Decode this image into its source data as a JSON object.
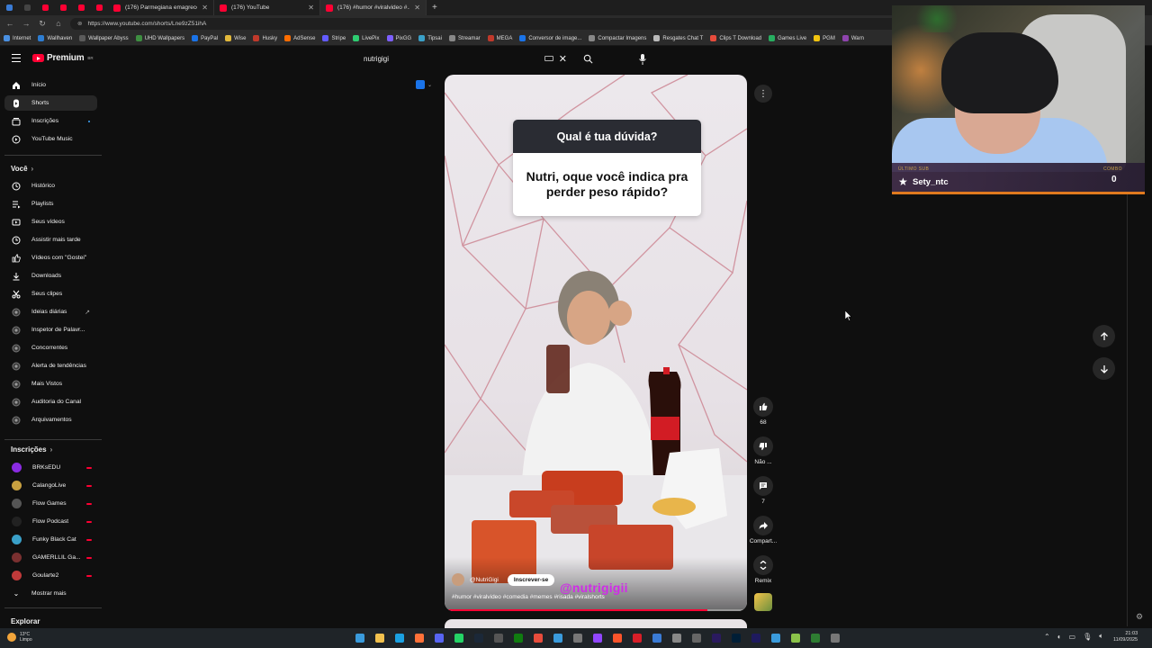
{
  "browser": {
    "tabs": [
      {
        "title": "(176) Parmegiana emagrece #...",
        "active": false
      },
      {
        "title": "(176) YouTube",
        "active": false
      },
      {
        "title": "(176) #humor #viralvideo #...",
        "active": true
      }
    ],
    "url": "https://www.youtube.com/shorts/Lne9zZ51ihA",
    "bookmarks": [
      "Internet",
      "Wallhaven",
      "Wallpaper Abyss",
      "UHD Wallpapers",
      "PayPal",
      "Wise",
      "Husky",
      "AdSense",
      "Stripe",
      "LivePix",
      "PixGG",
      "Tipsai",
      "Streamar",
      "MEGA",
      "Conversor de image...",
      "Compactar Imagens",
      "Resgates Chat T",
      "Clips T Download",
      "Games Live",
      "PGM",
      "Warn"
    ]
  },
  "header": {
    "logo_text": "Premium",
    "logo_sup": "BR",
    "search_value": "nutrigigi"
  },
  "sidebar": {
    "main": [
      {
        "label": "Início",
        "icon": "home-icon"
      },
      {
        "label": "Shorts",
        "icon": "shorts-icon",
        "active": true
      },
      {
        "label": "Inscrições",
        "icon": "subscriptions-icon"
      },
      {
        "label": "YouTube Music",
        "icon": "music-icon"
      }
    ],
    "you_title": "Você",
    "you": [
      {
        "label": "Histórico",
        "icon": "history-icon"
      },
      {
        "label": "Playlists",
        "icon": "playlist-icon"
      },
      {
        "label": "Seus vídeos",
        "icon": "video-icon"
      },
      {
        "label": "Assistir mais tarde",
        "icon": "clock-icon"
      },
      {
        "label": "Vídeos com \"Gostei\"",
        "icon": "like-icon"
      },
      {
        "label": "Downloads",
        "icon": "download-icon"
      },
      {
        "label": "Seus clipes",
        "icon": "scissors-icon"
      },
      {
        "label": "Ideias diárias",
        "icon": "extension-icon"
      },
      {
        "label": "Inspetor de Palavr...",
        "icon": "extension-icon"
      },
      {
        "label": "Concorrentes",
        "icon": "extension-icon"
      },
      {
        "label": "Alerta de tendências",
        "icon": "extension-icon"
      },
      {
        "label": "Mais Vistos",
        "icon": "extension-icon"
      },
      {
        "label": "Auditoria do Canal",
        "icon": "extension-icon"
      },
      {
        "label": "Arquivamentos",
        "icon": "extension-icon"
      }
    ],
    "subs_title": "Inscrições",
    "subs": [
      {
        "label": "BRKsEDU",
        "color": "#8a2be2"
      },
      {
        "label": "CalangoLive",
        "color": "#c8a040"
      },
      {
        "label": "Flow Games",
        "color": "#555555"
      },
      {
        "label": "Flow Podcast",
        "color": "#222222"
      },
      {
        "label": "Funky Black Cat",
        "color": "#3aa0c8"
      },
      {
        "label": "GAMERLLIL Ga...",
        "color": "#7a3030"
      },
      {
        "label": "Goularte2",
        "color": "#c03a3a"
      }
    ],
    "show_more": "Mostrar mais",
    "explore_title": "Explorar"
  },
  "short": {
    "card_question_title": "Qual é tua dúvida?",
    "card_question_body": "Nutri, oque você indica pra perder peso rápido?",
    "channel": "@NutriGigi",
    "subscribe": "Inscrever-se",
    "watermark": "@nutrigigii",
    "hashtags": "#humor #viralvideo #comedia #memes #risada #viralshorts",
    "progress": 0.87
  },
  "actions": {
    "likes": "68",
    "dislike": "Não ...",
    "comments": "7",
    "share": "Compart...",
    "remix": "Remix"
  },
  "stream_overlay": {
    "last_sub_label": "ÚLTIMO SUB",
    "last_sub_name": "Sety_ntc",
    "combo_label": "COMBO",
    "combo_value": "0"
  },
  "taskbar": {
    "temp": "13°C",
    "weather": "Limpo",
    "time": "21:03",
    "date": "11/09/2025"
  },
  "colors": {
    "accent": "#ff0033",
    "watermark": "#d02be8",
    "overlay_line": "#e07a1f"
  }
}
